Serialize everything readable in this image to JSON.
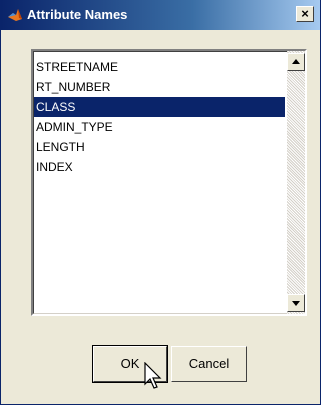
{
  "window": {
    "title": "Attribute Names",
    "close_glyph": "×"
  },
  "listbox": {
    "items": [
      "STREETNAME",
      "RT_NUMBER",
      "CLASS",
      "ADMIN_TYPE",
      "LENGTH",
      "INDEX"
    ],
    "selected_index": 2
  },
  "buttons": {
    "ok_label": "OK",
    "cancel_label": "Cancel"
  },
  "icons": {
    "title_icon": "matlab-icon",
    "scroll_up": "arrow-up-icon",
    "scroll_down": "arrow-down-icon",
    "cursor": "mouse-pointer-icon"
  },
  "colors": {
    "title_bar_start": "#0a246a",
    "title_bar_end": "#a6caf0",
    "selection": "#0a246a",
    "dialog_bg": "#ece9d8"
  }
}
